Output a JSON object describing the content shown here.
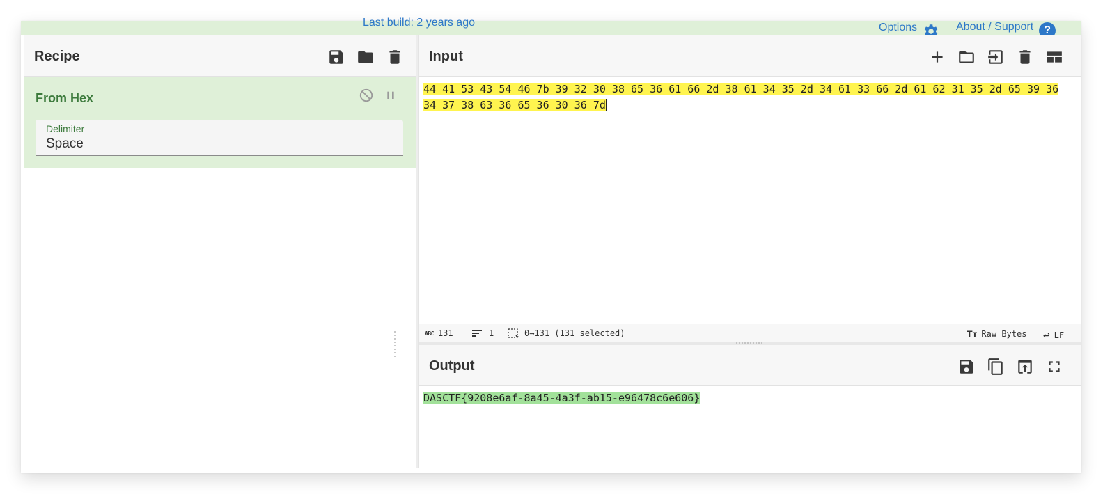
{
  "banner": {
    "last_build": "Last build: 2 years ago",
    "options": "Options",
    "about": "About / Support",
    "help_glyph": "?"
  },
  "recipe": {
    "title": "Recipe",
    "icons": [
      "save-icon",
      "folder-icon",
      "trash-icon"
    ],
    "operation": {
      "name": "From Hex",
      "controls": [
        "disable-icon",
        "breakpoint-icon"
      ],
      "field_label": "Delimiter",
      "field_value": "Space"
    }
  },
  "input": {
    "title": "Input",
    "icons": [
      "plus-icon",
      "folder-icon",
      "input-to-output-icon",
      "trash-icon",
      "layout-icon"
    ],
    "text": "44 41 53 43 54 46 7b 39 32 30 38 65 36 61 66 2d 38 61 34 35 2d 34 61 33 66 2d 61 62 31 35 2d 65 39 36 34 37 38 63 36 65 36 30 36 7d",
    "status": {
      "length": "131",
      "lines": "1",
      "selection": "0→131 (131 selected)",
      "encoding": "Raw Bytes",
      "eol": "LF"
    }
  },
  "output": {
    "title": "Output",
    "icons": [
      "save-icon",
      "copy-icon",
      "replace-input-icon",
      "maximise-icon"
    ],
    "text": "DASCTF{9208e6af-8a45-4a3f-ab15-e96478c6e606}"
  },
  "colors": {
    "accent_blue": "#2d78c8",
    "operation_bg": "#dff0d8",
    "operation_text": "#3c7a3c",
    "input_highlight": "#fff44f",
    "output_highlight": "#a2e19a"
  }
}
